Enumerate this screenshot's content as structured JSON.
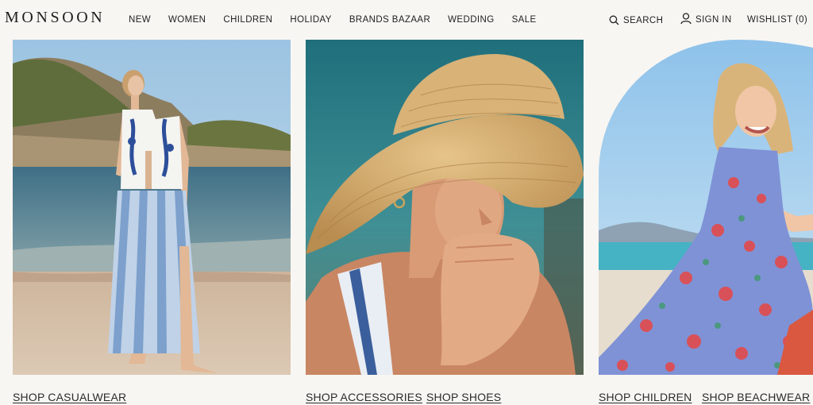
{
  "brand": {
    "logo_text": "MONSOON"
  },
  "nav": {
    "items": [
      {
        "label": "NEW"
      },
      {
        "label": "WOMEN"
      },
      {
        "label": "CHILDREN"
      },
      {
        "label": "HOLIDAY"
      },
      {
        "label": "BRANDS BAZAAR"
      },
      {
        "label": "WEDDING"
      },
      {
        "label": "SALE"
      }
    ]
  },
  "utility": {
    "search_label": "SEARCH",
    "search_icon": "search-icon",
    "signin_label": "SIGN IN",
    "signin_icon": "user-icon",
    "wishlist_label": "WISHLIST (0)"
  },
  "tiles": [
    {
      "image": "woman in embroidered waistcoat and striped maxi skirt on beach",
      "links": [
        "SHOP CASUALWEAR"
      ]
    },
    {
      "image": "woman in wide straw sun hat",
      "links": [
        "SHOP ACCESSORIES",
        "SHOP SHOES"
      ]
    },
    {
      "image": "girl in floral tiered sundress on beach",
      "links": [
        "SHOP CHILDREN",
        "SHOP BEACHWEAR"
      ]
    }
  ],
  "colors": {
    "background": "#f8f6f2",
    "text": "#222222"
  }
}
